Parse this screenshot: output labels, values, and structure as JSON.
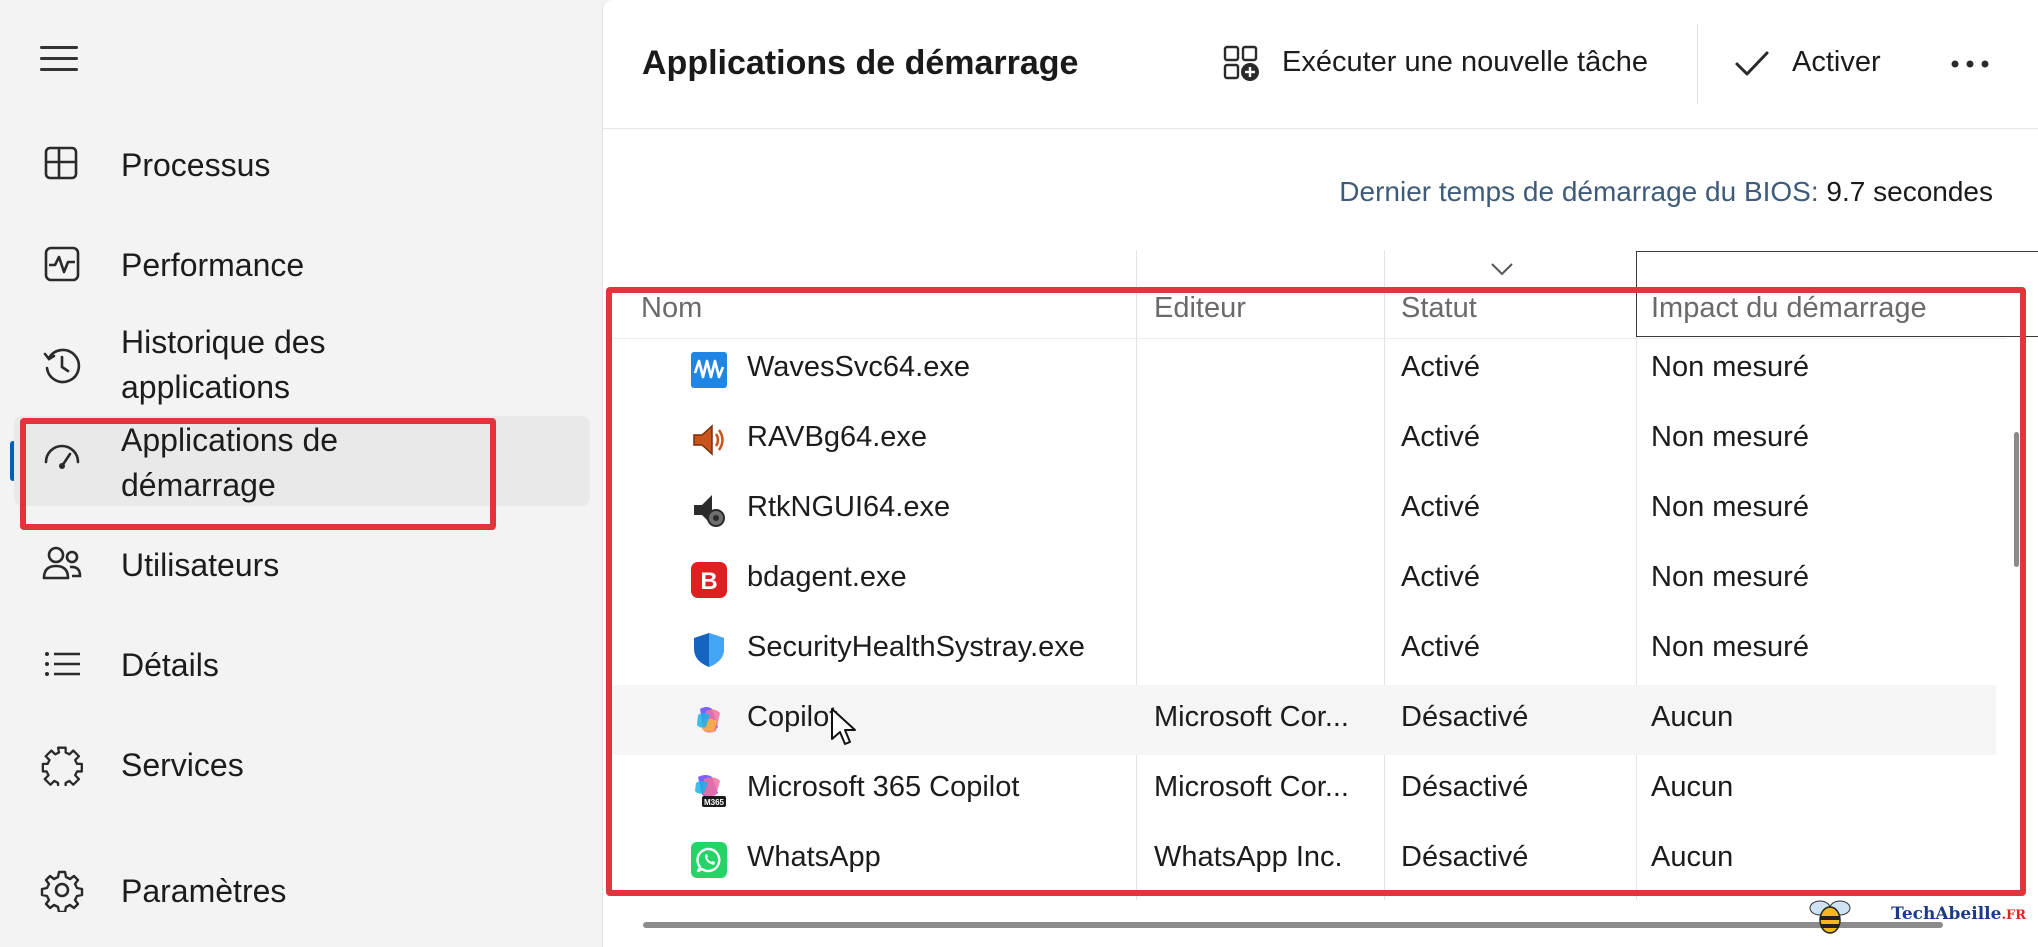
{
  "sidebar": {
    "items": [
      {
        "label": "Processus",
        "icon": "processes-icon"
      },
      {
        "label": "Performance",
        "icon": "performance-icon"
      },
      {
        "label": "Historique des applications",
        "icon": "app-history-icon"
      },
      {
        "label": "Applications de démarrage",
        "icon": "startup-apps-icon",
        "active": true
      },
      {
        "label": "Utilisateurs",
        "icon": "users-icon"
      },
      {
        "label": "Détails",
        "icon": "details-icon"
      },
      {
        "label": "Services",
        "icon": "services-icon"
      }
    ],
    "settings_label": "Paramètres"
  },
  "toolbar": {
    "title": "Applications de démarrage",
    "run_task_label": "Exécuter une nouvelle tâche",
    "enable_label": "Activer"
  },
  "bios": {
    "label": "Dernier temps de démarrage du BIOS:",
    "value": "9.7 secondes"
  },
  "table": {
    "columns": [
      "Nom",
      "Editeur",
      "Statut",
      "Impact du démarrage"
    ],
    "rows": [
      {
        "name": "WavesSvc64.exe",
        "publisher": "",
        "status": "Activé",
        "impact": "Non mesuré",
        "icon": "waves-icon"
      },
      {
        "name": "RAVBg64.exe",
        "publisher": "",
        "status": "Activé",
        "impact": "Non mesuré",
        "icon": "speaker-icon"
      },
      {
        "name": "RtkNGUI64.exe",
        "publisher": "",
        "status": "Activé",
        "impact": "Non mesuré",
        "icon": "realtek-speaker-icon"
      },
      {
        "name": "bdagent.exe",
        "publisher": "",
        "status": "Activé",
        "impact": "Non mesuré",
        "icon": "bitdefender-icon"
      },
      {
        "name": "SecurityHealthSystray.exe",
        "publisher": "",
        "status": "Activé",
        "impact": "Non mesuré",
        "icon": "windows-security-shield-icon"
      },
      {
        "name": "Copilot",
        "publisher": "Microsoft Cor...",
        "status": "Désactivé",
        "impact": "Aucun",
        "icon": "copilot-icon"
      },
      {
        "name": "Microsoft 365 Copilot",
        "publisher": "Microsoft Cor...",
        "status": "Désactivé",
        "impact": "Aucun",
        "icon": "m365-copilot-icon"
      },
      {
        "name": "WhatsApp",
        "publisher": "WhatsApp Inc.",
        "status": "Désactivé",
        "impact": "Aucun",
        "icon": "whatsapp-icon"
      }
    ]
  },
  "watermark": {
    "text": "TechAbeille",
    "suffix": ".FR"
  },
  "colors": {
    "highlight_red": "#e2343c",
    "accent_blue": "#005fb8"
  }
}
